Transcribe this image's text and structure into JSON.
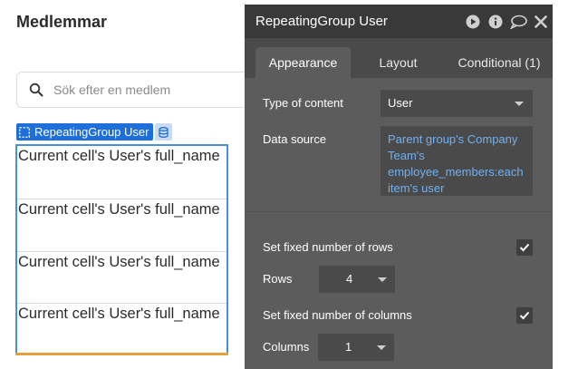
{
  "page": {
    "title": "Medlemmar",
    "search": {
      "placeholder": "Sök efter en medlem",
      "value": ""
    }
  },
  "repeating_group": {
    "tag_label": "RepeatingGroup User",
    "cells": [
      "Current cell's User's full_name",
      "Current cell's User's full_name",
      "Current cell's User's full_name",
      "Current cell's User's full_name"
    ]
  },
  "panel": {
    "title": "RepeatingGroup User",
    "tabs": [
      {
        "label": "Appearance",
        "active": true
      },
      {
        "label": "Layout",
        "active": false
      },
      {
        "label": "Conditional (1)",
        "active": false
      }
    ],
    "type_of_content": {
      "label": "Type of content",
      "value": "User"
    },
    "data_source": {
      "label": "Data source",
      "value": "Parent group's Company Team's employee_members:each item's user"
    },
    "fixed_rows": {
      "label": "Set fixed number of rows",
      "checked": true
    },
    "rows": {
      "label": "Rows",
      "value": "4"
    },
    "fixed_columns": {
      "label": "Set fixed number of columns",
      "checked": true
    },
    "columns": {
      "label": "Columns",
      "value": "1"
    }
  },
  "colors": {
    "accent_blue": "#1e6fd9",
    "panel_bg": "#5c5c5c",
    "panel_header_bg": "#393939",
    "link_blue": "#6fb1f2",
    "selection_orange": "#e4a13c"
  },
  "icons": [
    "search-icon",
    "repeating-group-icon",
    "database-icon",
    "play-icon",
    "info-icon",
    "comment-icon",
    "close-icon",
    "chevron-down-icon",
    "checkmark-icon"
  ]
}
